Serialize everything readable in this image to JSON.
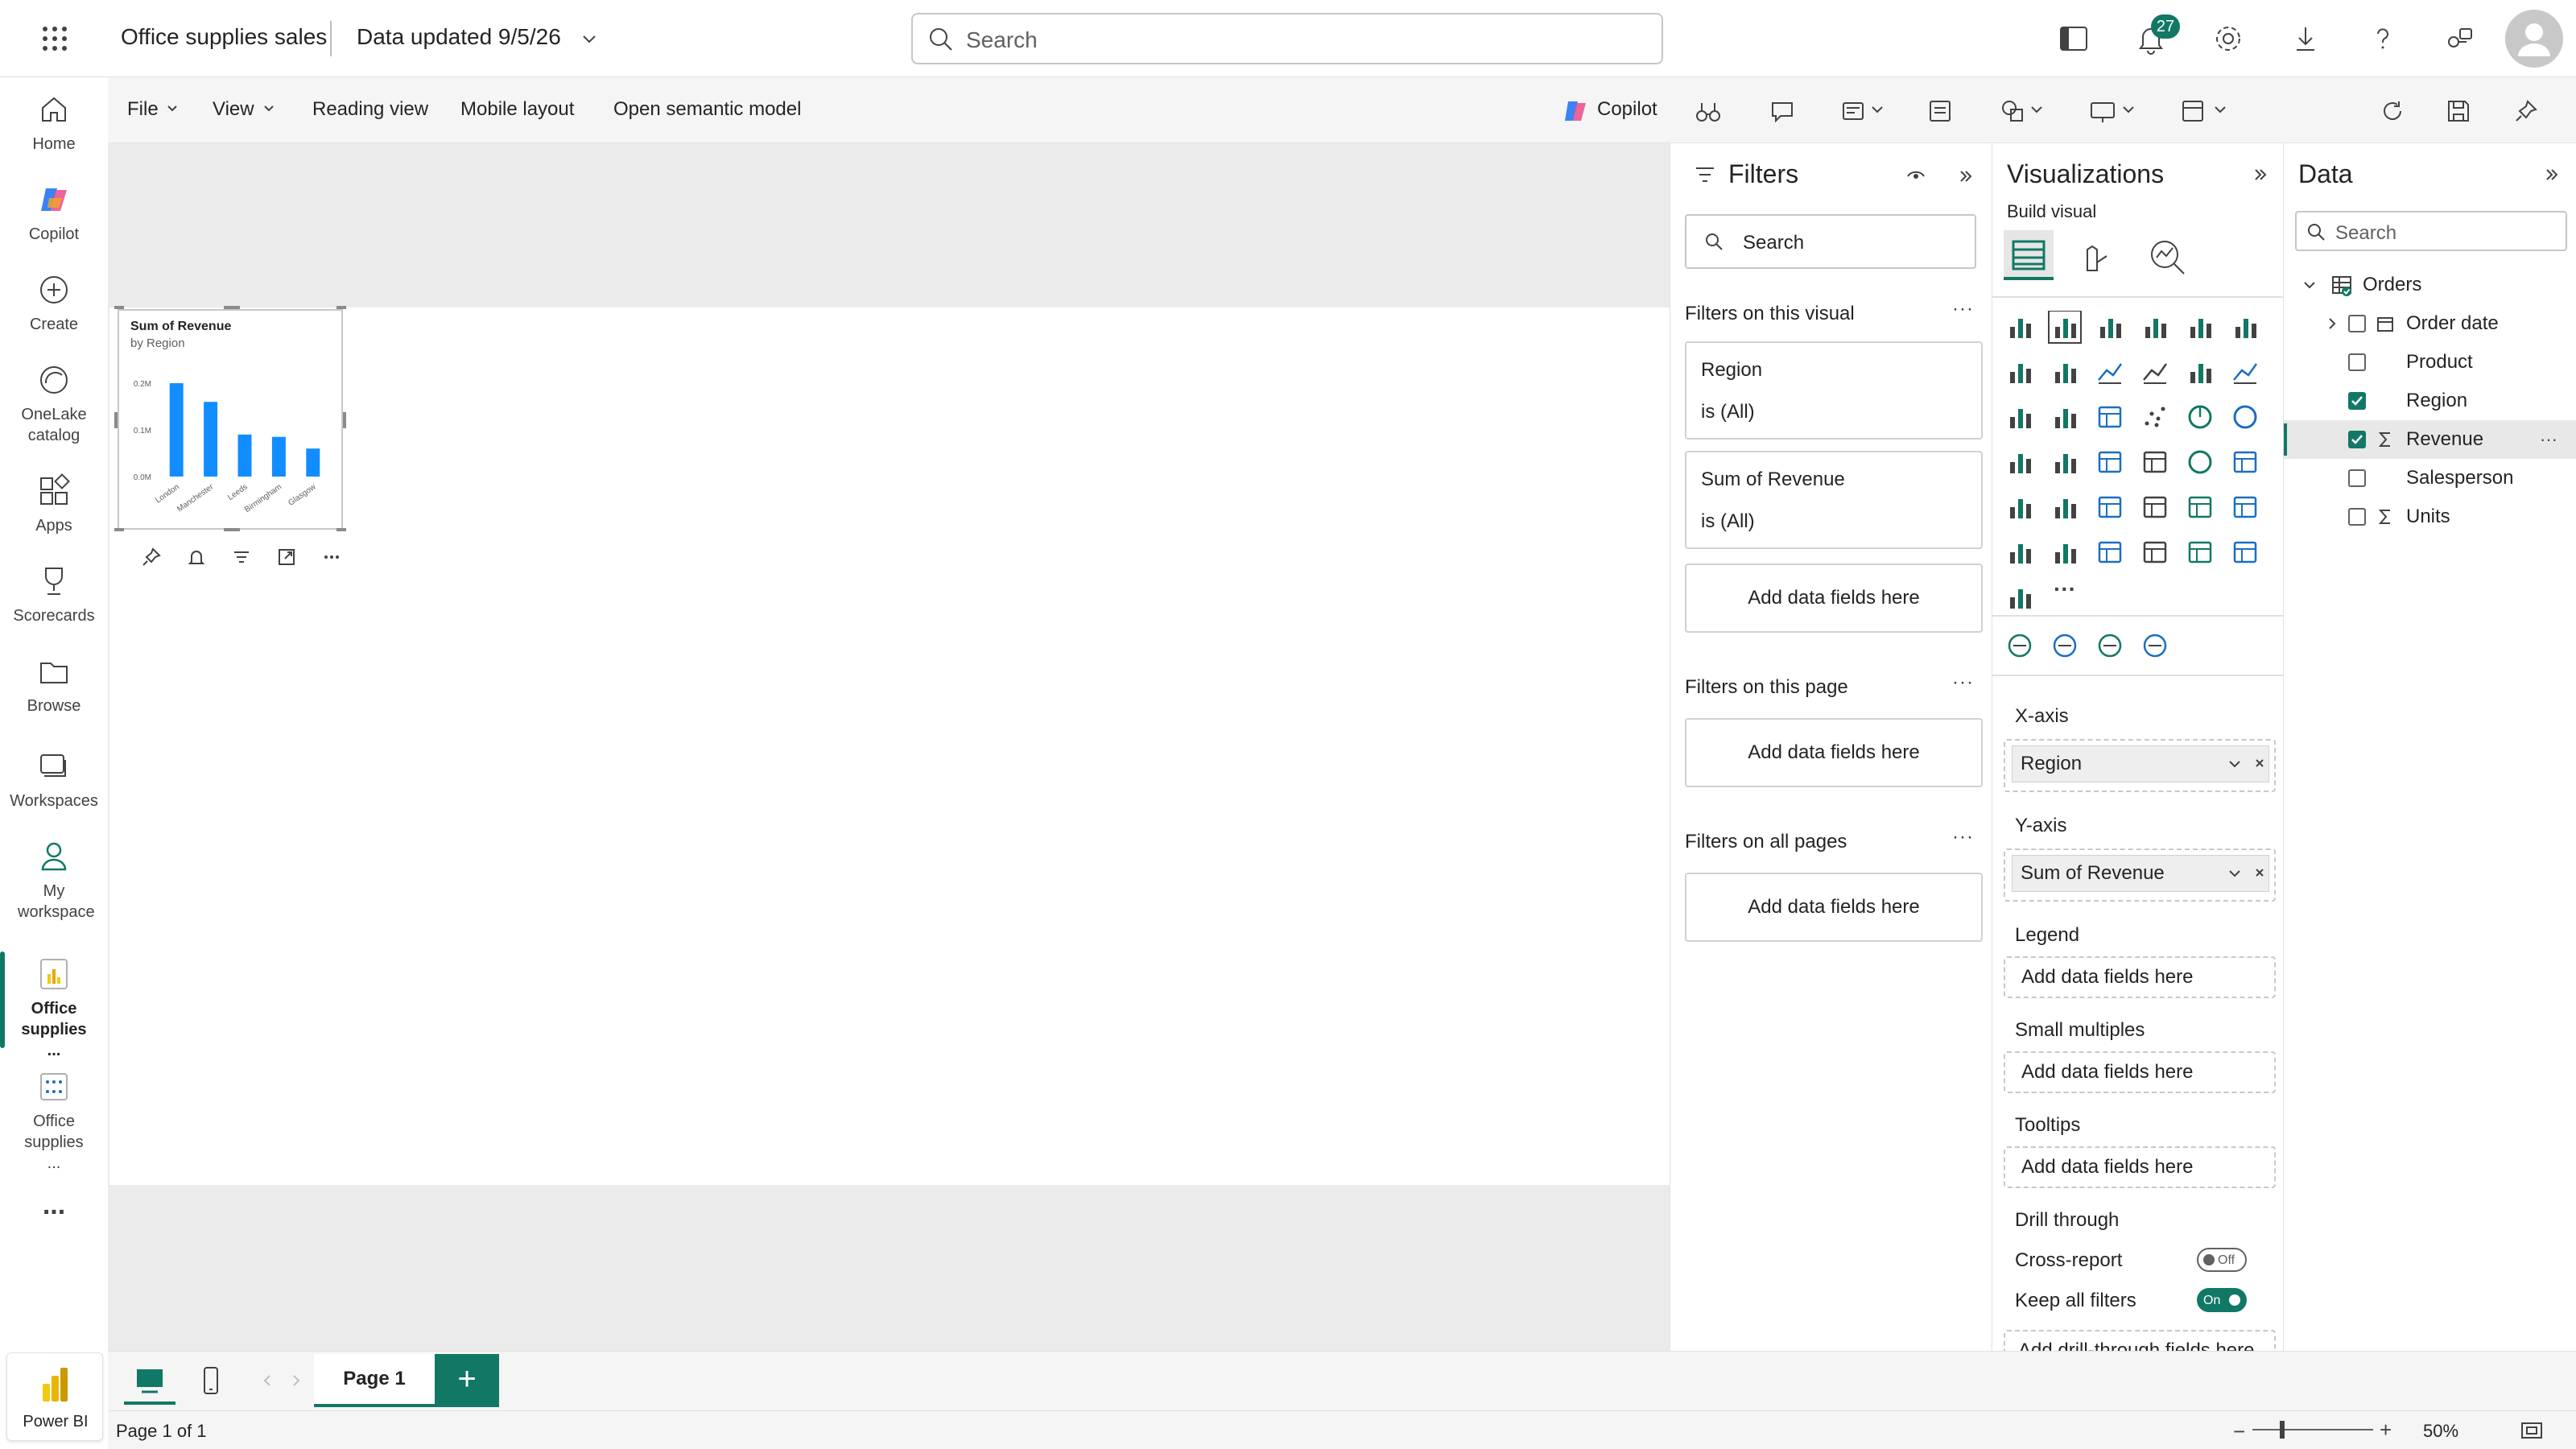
{
  "topbar": {
    "app_title": "Office supplies sales",
    "data_updated": "Data updated 9/5/26",
    "search_placeholder": "Search",
    "notification_count": "27"
  },
  "left_rail": {
    "items": [
      {
        "label": "Home",
        "icon": "home-icon"
      },
      {
        "label": "Copilot",
        "icon": "copilot-icon"
      },
      {
        "label": "Create",
        "icon": "create-icon"
      },
      {
        "label": "OneLake catalog",
        "icon": "onelake-icon"
      },
      {
        "label": "Apps",
        "icon": "apps-icon"
      },
      {
        "label": "Scorecards",
        "icon": "trophy-icon"
      },
      {
        "label": "Browse",
        "icon": "folder-icon"
      },
      {
        "label": "Workspaces",
        "icon": "workspaces-icon"
      },
      {
        "label": "My workspace",
        "icon": "person-icon"
      },
      {
        "label": "Office supplies ...",
        "icon": "report-icon"
      },
      {
        "label": "Office supplies ...",
        "icon": "semantic-model-icon"
      }
    ],
    "more": "...",
    "powerbi_label": "Power BI"
  },
  "ribbon": {
    "file": "File",
    "view": "View",
    "reading_view": "Reading view",
    "mobile_layout": "Mobile layout",
    "open_semantic_model": "Open semantic model",
    "copilot": "Copilot"
  },
  "chart_data": {
    "type": "bar",
    "title": "Sum of Revenue",
    "subtitle": "by Region",
    "categories": [
      "London",
      "Manchester",
      "Leeds",
      "Birmingham",
      "Glasgow"
    ],
    "values": [
      0.2,
      0.16,
      0.09,
      0.085,
      0.06
    ],
    "y_ticks": [
      "0.2M",
      "0.1M",
      "0.0M"
    ],
    "ylim": [
      0,
      0.2
    ],
    "color": "#118DFF"
  },
  "filters": {
    "title": "Filters",
    "search_placeholder": "Search",
    "on_visual": "Filters on this visual",
    "cards": [
      {
        "field": "Region",
        "state": "is (All)"
      },
      {
        "field": "Sum of Revenue",
        "state": "is (All)"
      }
    ],
    "add_fields": "Add data fields here",
    "on_page": "Filters on this page",
    "on_all_pages": "Filters on all pages"
  },
  "viz": {
    "title": "Visualizations",
    "build_visual": "Build visual",
    "x_axis": "X-axis",
    "x_field": "Region",
    "y_axis": "Y-axis",
    "y_field": "Sum of Revenue",
    "legend": "Legend",
    "small_multiples": "Small multiples",
    "tooltips": "Tooltips",
    "drill_through": "Drill through",
    "cross_report": "Cross-report",
    "cross_report_state": "Off",
    "keep_all_filters": "Keep all filters",
    "keep_all_filters_state": "On",
    "add_fields": "Add data fields here",
    "add_drill": "Add drill-through fields here"
  },
  "data_pane": {
    "title": "Data",
    "search_placeholder": "Search",
    "table": "Orders",
    "fields": [
      {
        "name": "Order date",
        "checked": false,
        "type": "date"
      },
      {
        "name": "Product",
        "checked": false,
        "type": "text"
      },
      {
        "name": "Region",
        "checked": true,
        "type": "text"
      },
      {
        "name": "Revenue",
        "checked": true,
        "type": "sum"
      },
      {
        "name": "Salesperson",
        "checked": false,
        "type": "text"
      },
      {
        "name": "Units",
        "checked": false,
        "type": "sum"
      }
    ]
  },
  "pages": {
    "tab": "Page 1",
    "add": "+",
    "status": "Page 1 of 1",
    "zoom": "50%"
  }
}
